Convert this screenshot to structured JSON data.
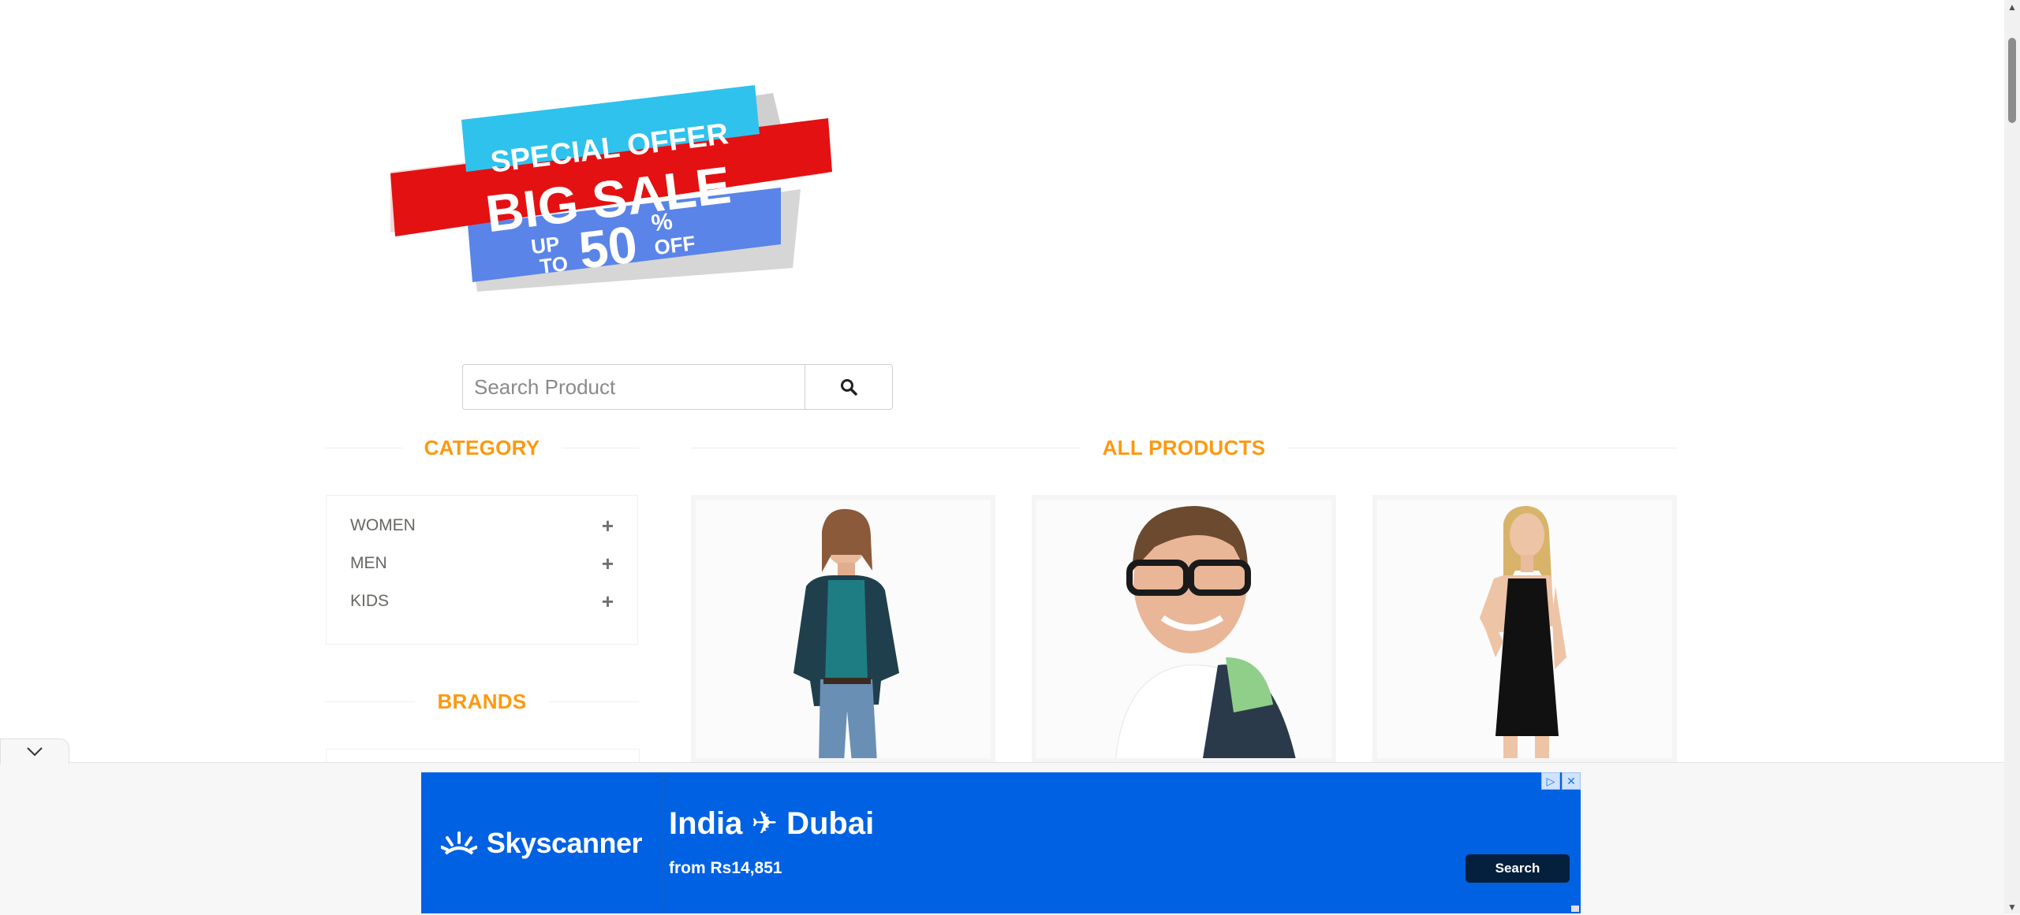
{
  "banner": {
    "line1": "SPECIAL OFFER",
    "line2": "BIG SALE",
    "line3_up": "UP",
    "line3_to": "TO",
    "line3_value": "50",
    "line3_pct": "%",
    "line3_off": "OFF"
  },
  "search": {
    "placeholder": "Search Product"
  },
  "sidebar": {
    "category_title": "CATEGORY",
    "categories": [
      {
        "label": "WOMEN"
      },
      {
        "label": "MEN"
      },
      {
        "label": "KIDS"
      }
    ],
    "brands_title": "BRANDS"
  },
  "main": {
    "products_title": "ALL PRODUCTS"
  },
  "ad": {
    "brand": "Skyscanner",
    "route_from": "India",
    "route_to": "Dubai",
    "price": "from Rs14,851",
    "button": "Search"
  },
  "colors": {
    "accent": "#fe980f",
    "ad_blue": "#0062e3",
    "ad_button": "#05203c"
  }
}
